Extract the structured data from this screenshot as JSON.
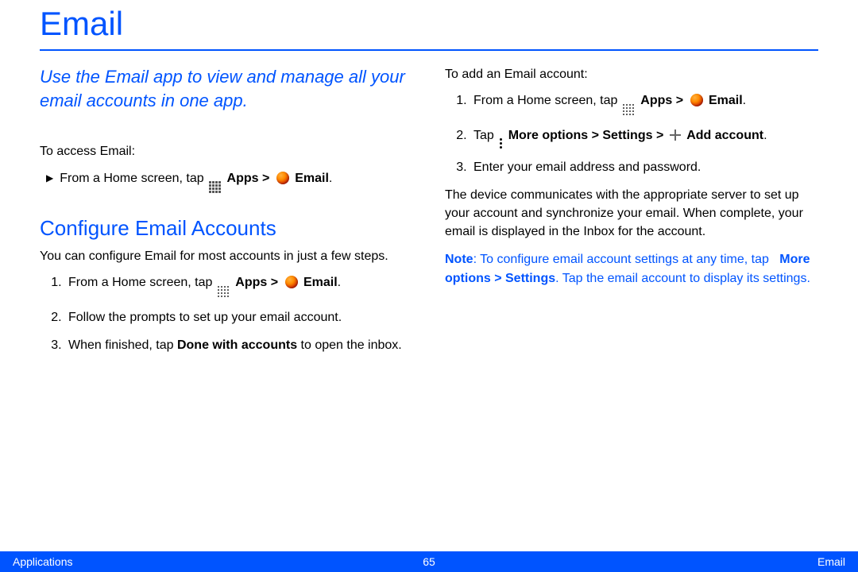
{
  "title": "Email",
  "intro": "Use the Email app to view and manage all your email accounts in one app.",
  "left": {
    "access_lead": "To access Email:",
    "access_step_prefix": "From a Home screen, tap ",
    "apps_label": "Apps > ",
    "email_label": " Email",
    "configure_heading": "Configure Email Accounts",
    "configure_intro": "You can configure Email for most accounts in just a few steps.",
    "steps": {
      "s1_prefix": "From a Home screen, tap ",
      "s1_apps": "Apps > ",
      "s1_email": " Email",
      "s2": "Follow the prompts to set up your email account.",
      "s3_prefix": "When finished, tap ",
      "s3_bold": "Done with accounts",
      "s3_suffix": " to open the inbox."
    }
  },
  "right": {
    "add_lead": "To add an Email account:",
    "steps": {
      "s1_prefix": "From a Home screen, tap ",
      "s1_apps": "Apps > ",
      "s1_email": " Email",
      "s2_prefix": "Tap ",
      "s2_more": " More options > Settings > ",
      "s2_add": " Add account",
      "s3": "Enter your email address and password."
    },
    "sync_para": "The device communicates with the appropriate server to set up your account and synchronize your email. When complete, your email is displayed in the Inbox for the account.",
    "note_label": "Note",
    "note_prefix": ": To configure email account settings at any time, tap ",
    "note_bold": "More options > Settings",
    "note_suffix": ". Tap the email account to display its settings."
  },
  "footer": {
    "left": "Applications",
    "page": "65",
    "right": "Email"
  },
  "period": "."
}
